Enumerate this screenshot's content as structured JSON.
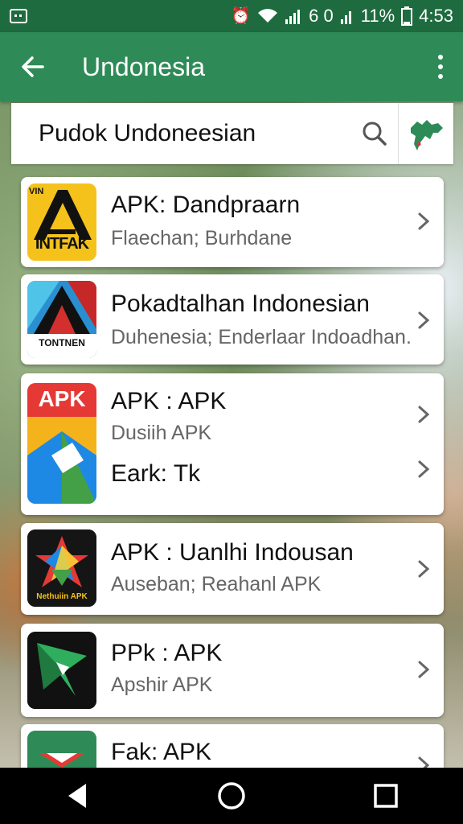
{
  "status_bar": {
    "network": "6 0",
    "battery": "11%",
    "time": "4:53"
  },
  "app_bar": {
    "title": "Undonesia"
  },
  "search": {
    "value": "Pudok Undoneesian"
  },
  "apps": [
    {
      "icon_text": "INTFAK",
      "icon_top_text": "VIN",
      "title": "APK: Dandpraarn",
      "subtitle": "Flaechan; Burhdane"
    },
    {
      "icon_text": "TONTNEN",
      "title": "Pokadtalhan Indonesian",
      "subtitle": "Duhenesia; Enderlaar Indoadhan."
    },
    {
      "icon_text": "APK",
      "title": "APK : APK",
      "subtitle": "Dusiih APK",
      "title2": "Eark: Tk"
    },
    {
      "icon_text": "Nethuiin APK",
      "title": "APK : Uanlhi Indousan",
      "subtitle": "Auseban; Reahanl APK"
    },
    {
      "title": "PPk : APK",
      "subtitle": "Apshir APK"
    },
    {
      "title": "Fak: APK"
    }
  ],
  "colors": {
    "status_bar": "#1e6b3f",
    "app_bar": "#2e8b57",
    "accent": "#2e8b57"
  }
}
